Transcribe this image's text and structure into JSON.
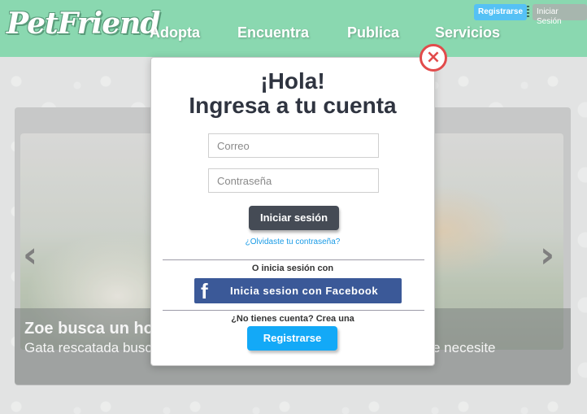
{
  "header": {
    "logo": "PetFriend",
    "nav": [
      "Adopta",
      "Encuentra",
      "Publica",
      "Servicios"
    ],
    "register_label": "Registrarse",
    "login_label": "Iniciar Sesión"
  },
  "carousel": {
    "prev_icon": "‹",
    "next_icon": "›",
    "caption_title": "Zoe busca un hog",
    "caption_text": "Gata rescatada busc",
    "caption_text_end": "e necesite"
  },
  "modal": {
    "close_icon": "×",
    "greeting": "¡Hola!",
    "title": "Ingresa a tu cuenta",
    "email_placeholder": "Correo",
    "password_placeholder": "Contraseña",
    "login_button": "Iniciar sesión",
    "forgot_link": "¿Olvidaste tu contraseña?",
    "or_text": "O inicia sesión con",
    "facebook_icon": "f",
    "facebook_button": "Inicia sesion con Facebook",
    "no_account_text": "¿No tienes cuenta? Crea una",
    "register_button": "Registrarse"
  },
  "colors": {
    "header_bg": "#8ad8b0",
    "login_button_bg": "#454b55",
    "facebook_bg": "#3b5998",
    "register_bg": "#13a9f7",
    "close_red": "#e24b4b"
  }
}
